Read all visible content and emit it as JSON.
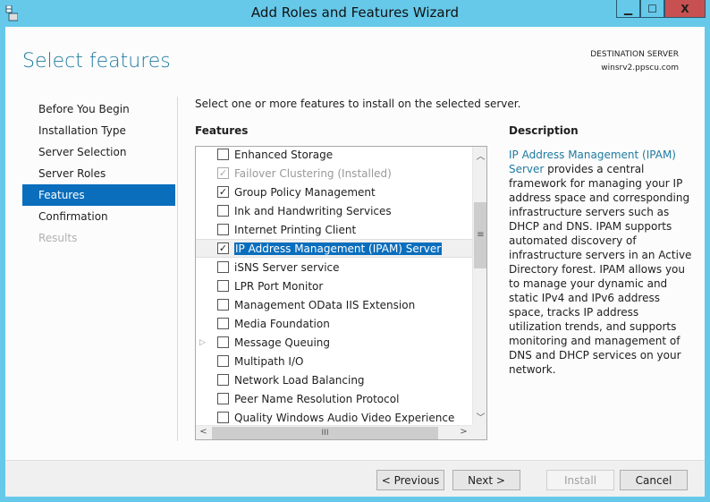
{
  "window": {
    "title": "Add Roles and Features Wizard",
    "minimize": "▁",
    "maximize": "☐",
    "close": "X",
    "close_color": "#c75050",
    "titlebar_color": "#66c9ea"
  },
  "page": {
    "title": "Select features",
    "destination_label": "DESTINATION SERVER",
    "destination_server": "winsrv2.ppscu.com"
  },
  "nav": [
    {
      "label": "Before You Begin",
      "state": "normal"
    },
    {
      "label": "Installation Type",
      "state": "normal"
    },
    {
      "label": "Server Selection",
      "state": "normal"
    },
    {
      "label": "Server Roles",
      "state": "normal"
    },
    {
      "label": "Features",
      "state": "active"
    },
    {
      "label": "Confirmation",
      "state": "normal"
    },
    {
      "label": "Results",
      "state": "disabled"
    }
  ],
  "main": {
    "intro": "Select one or more features to install on the selected server.",
    "features_header": "Features",
    "description_header": "Description",
    "features": [
      {
        "label": "Enhanced Storage",
        "checked": false
      },
      {
        "label": "Failover Clustering (Installed)",
        "checked": true,
        "disabled": true
      },
      {
        "label": "Group Policy Management",
        "checked": true
      },
      {
        "label": "Ink and Handwriting Services",
        "checked": false
      },
      {
        "label": "Internet Printing Client",
        "checked": false
      },
      {
        "label": "IP Address Management (IPAM) Server",
        "checked": true,
        "selected": true
      },
      {
        "label": "iSNS Server service",
        "checked": false
      },
      {
        "label": "LPR Port Monitor",
        "checked": false
      },
      {
        "label": "Management OData IIS Extension",
        "checked": false
      },
      {
        "label": "Media Foundation",
        "checked": false
      },
      {
        "label": "Message Queuing",
        "checked": false,
        "expandable": true
      },
      {
        "label": "Multipath I/O",
        "checked": false
      },
      {
        "label": "Network Load Balancing",
        "checked": false
      },
      {
        "label": "Peer Name Resolution Protocol",
        "checked": false
      },
      {
        "label": "Quality Windows Audio Video Experience",
        "checked": false
      }
    ],
    "description_link": "IP Address Management (IPAM) Server",
    "description_text": " provides a central framework for managing your IP address space and corresponding infrastructure servers such as DHCP and DNS. IPAM supports automated discovery of infrastructure servers in an Active Directory forest. IPAM allows you to manage your dynamic and static IPv4 and IPv6 address space, tracks IP address utilization trends, and supports monitoring and management of DNS and DHCP services on your network."
  },
  "footer": {
    "previous": "< Previous",
    "next": "Next >",
    "install": "Install",
    "cancel": "Cancel"
  }
}
